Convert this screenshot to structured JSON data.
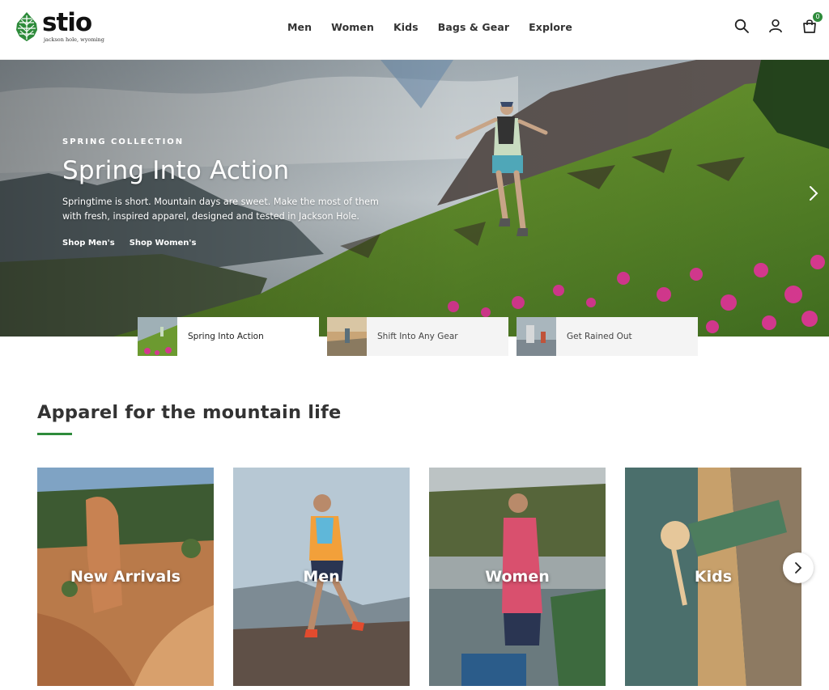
{
  "brand": {
    "name": "stio",
    "tagline": "jackson hole, wyoming",
    "accent_color": "#2e8b3b"
  },
  "nav": {
    "items": [
      {
        "label": "Men"
      },
      {
        "label": "Women"
      },
      {
        "label": "Kids"
      },
      {
        "label": "Bags & Gear"
      },
      {
        "label": "Explore"
      }
    ]
  },
  "header_icons": {
    "search": "search-icon",
    "account": "user-icon",
    "cart": "bag-icon",
    "cart_count": "0"
  },
  "hero": {
    "eyebrow": "SPRING COLLECTION",
    "title": "Spring Into Action",
    "description": "Springtime is short. Mountain days are sweet. Make the most of them with fresh, inspired apparel, designed and tested in Jackson Hole.",
    "links": [
      {
        "label": "Shop Men's"
      },
      {
        "label": "Shop Women's"
      }
    ],
    "next_icon": "chevron-right-icon"
  },
  "hero_tabs": [
    {
      "label": "Spring Into Action",
      "active": true
    },
    {
      "label": "Shift Into Any Gear",
      "active": false
    },
    {
      "label": "Get Rained Out",
      "active": false
    }
  ],
  "section": {
    "title": "Apparel for the mountain life"
  },
  "categories": [
    {
      "label": "New Arrivals"
    },
    {
      "label": "Men"
    },
    {
      "label": "Women"
    },
    {
      "label": "Kids"
    }
  ],
  "carousel_next_icon": "chevron-right-icon"
}
